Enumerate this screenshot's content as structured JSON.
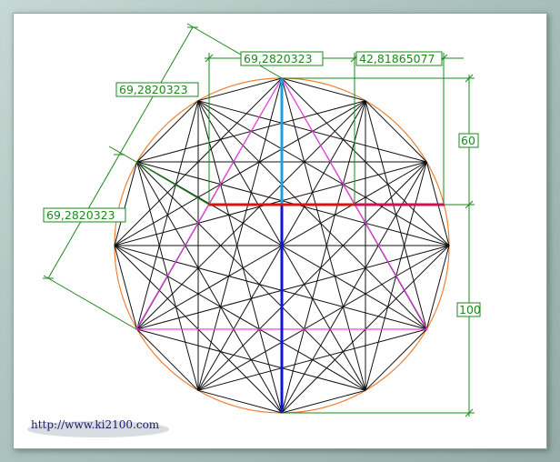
{
  "dimensions": {
    "top_width": "69,2820323",
    "right_offset": "42,81865077",
    "left_upper": "69,2820323",
    "left_lower": "69,2820323",
    "right_upper": "60",
    "right_lower": "100"
  },
  "watermark": {
    "url": "http://www.ki2100.com"
  },
  "colors": {
    "circle": "#f08030",
    "dimension": "#1b8a1b",
    "triangle": "#ee44ee",
    "red_bar": "#dd1111",
    "blue_upper": "#1aa0e6",
    "blue_lower": "#1414d8",
    "frame": "#a9bfb9"
  }
}
